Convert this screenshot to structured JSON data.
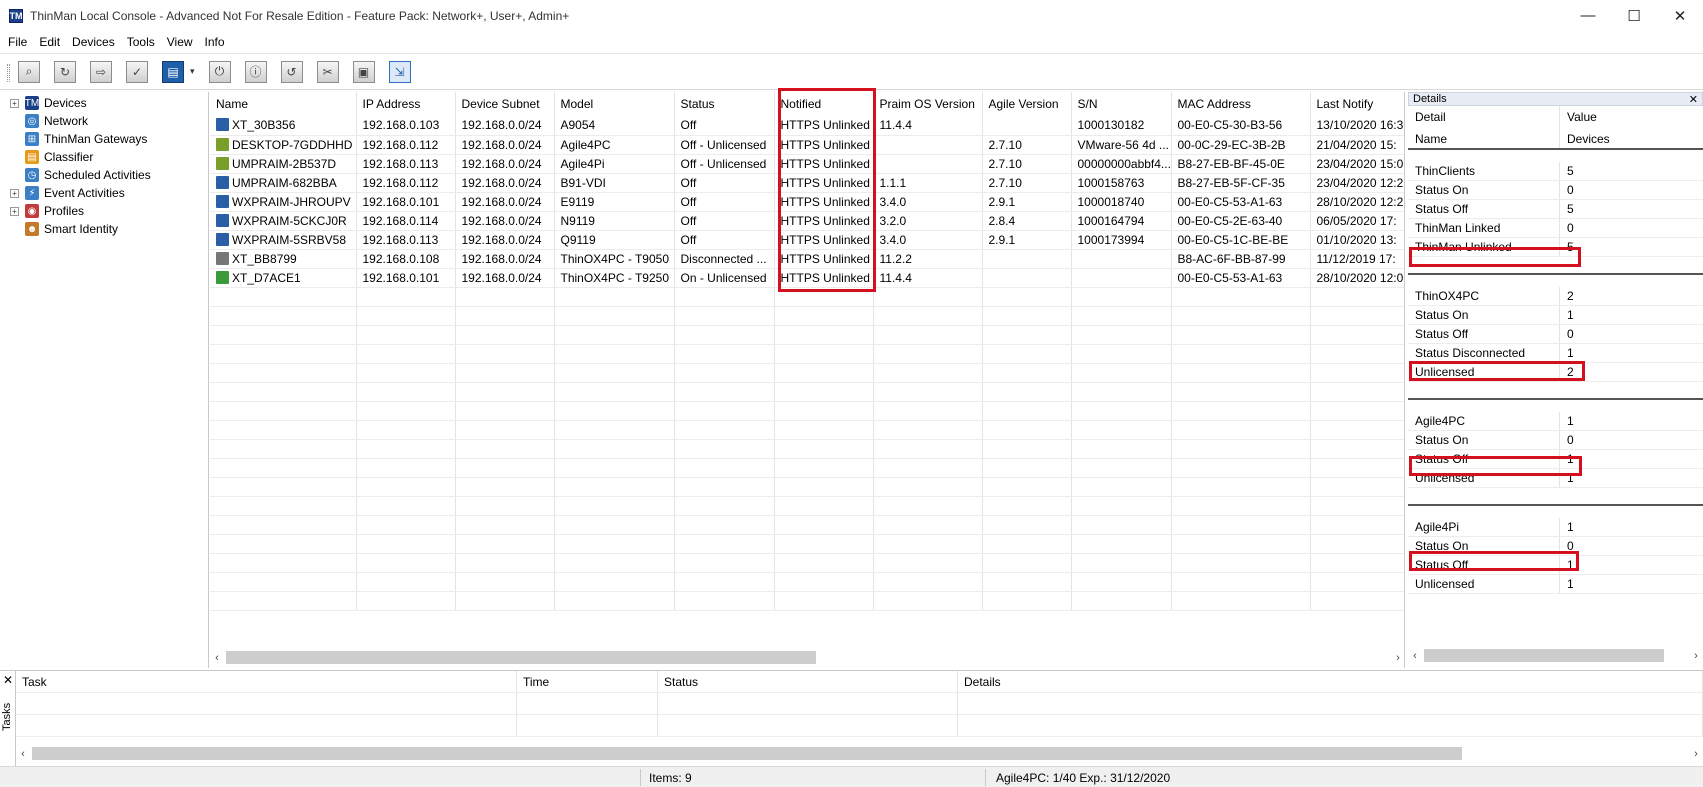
{
  "window": {
    "title": "ThinMan Local Console - Advanced Not For Resale Edition - Feature Pack: Network+, User+, Admin+",
    "app_icon_text": "TM",
    "minimize": "—",
    "maximize": "☐",
    "close": "✕"
  },
  "menu": [
    "File",
    "Edit",
    "Devices",
    "Tools",
    "View",
    "Info"
  ],
  "toolbar": {
    "buttons": [
      "search-icon",
      "refresh-icon",
      "export-icon",
      "checklist-icon",
      "details-view-icon",
      "power-icon",
      "info-icon",
      "undo-icon",
      "tools-icon",
      "window-icon",
      "select-icon"
    ],
    "dropdown": "▾"
  },
  "tree": [
    {
      "label": "Devices",
      "expander": "+",
      "icon": "TM",
      "color": "#1a3f8a"
    },
    {
      "label": "Network",
      "expander": "",
      "icon": "◎",
      "color": "#3c7fc4"
    },
    {
      "label": "ThinMan Gateways",
      "expander": "",
      "icon": "⊞",
      "color": "#3c7fc4"
    },
    {
      "label": "Classifier",
      "expander": "",
      "icon": "▤",
      "color": "#e59a1d"
    },
    {
      "label": "Scheduled Activities",
      "expander": "",
      "icon": "◷",
      "color": "#3c7fc4"
    },
    {
      "label": "Event Activities",
      "expander": "+",
      "icon": "⚡",
      "color": "#3c7fc4"
    },
    {
      "label": "Profiles",
      "expander": "+",
      "icon": "◉",
      "color": "#c23b3b"
    },
    {
      "label": "Smart Identity",
      "expander": "",
      "icon": "☻",
      "color": "#c07a2a"
    }
  ],
  "devices": {
    "columns": [
      "Name",
      "IP Address",
      "Device Subnet",
      "Model",
      "Status",
      "Notified",
      "Praim OS Version",
      "Agile Version",
      "S/N",
      "MAC Address",
      "Last Notify"
    ],
    "rows": [
      {
        "name": "XT_30B356",
        "ip": "192.168.0.103",
        "subnet": "192.168.0.0/24",
        "model": "A9054",
        "status": "Off",
        "notified": "HTTPS Unlinked",
        "os": "11.4.4",
        "agile": "",
        "sn": "1000130182",
        "mac": "00-E0-C5-30-B3-56",
        "last": "13/10/2020 16:3",
        "icon_color": "#2a5fa8"
      },
      {
        "name": "DESKTOP-7GDDHHD",
        "ip": "192.168.0.112",
        "subnet": "192.168.0.0/24",
        "model": "Agile4PC",
        "status": "Off - Unlicensed",
        "notified": "HTTPS Unlinked",
        "os": "",
        "agile": "2.7.10",
        "sn": "VMware-56 4d ...",
        "mac": "00-0C-29-EC-3B-2B",
        "last": "21/04/2020 15:",
        "icon_color": "#7a9e2a"
      },
      {
        "name": "UMPRAIM-2B537D",
        "ip": "192.168.0.113",
        "subnet": "192.168.0.0/24",
        "model": "Agile4Pi",
        "status": "Off - Unlicensed",
        "notified": "HTTPS Unlinked",
        "os": "",
        "agile": "2.7.10",
        "sn": "00000000abbf4...",
        "mac": "B8-27-EB-BF-45-0E",
        "last": "23/04/2020 15:0",
        "icon_color": "#7a9e2a"
      },
      {
        "name": "UMPRAIM-682BBA",
        "ip": "192.168.0.112",
        "subnet": "192.168.0.0/24",
        "model": "B91-VDI",
        "status": "Off",
        "notified": "HTTPS Unlinked",
        "os": "1.1.1",
        "agile": "2.7.10",
        "sn": "1000158763",
        "mac": "B8-27-EB-5F-CF-35",
        "last": "23/04/2020 12:2",
        "icon_color": "#2a5fa8"
      },
      {
        "name": "WXPRAIM-JHROUPV",
        "ip": "192.168.0.101",
        "subnet": "192.168.0.0/24",
        "model": "E9119",
        "status": "Off",
        "notified": "HTTPS Unlinked",
        "os": "3.4.0",
        "agile": "2.9.1",
        "sn": "1000018740",
        "mac": "00-E0-C5-53-A1-63",
        "last": "28/10/2020 12:2",
        "icon_color": "#2a5fa8"
      },
      {
        "name": "WXPRAIM-5CKCJ0R",
        "ip": "192.168.0.114",
        "subnet": "192.168.0.0/24",
        "model": "N9119",
        "status": "Off",
        "notified": "HTTPS Unlinked",
        "os": "3.2.0",
        "agile": "2.8.4",
        "sn": "1000164794",
        "mac": "00-E0-C5-2E-63-40",
        "last": "06/05/2020 17:",
        "icon_color": "#2a5fa8"
      },
      {
        "name": "WXPRAIM-5SRBV58",
        "ip": "192.168.0.113",
        "subnet": "192.168.0.0/24",
        "model": "Q9119",
        "status": "Off",
        "notified": "HTTPS Unlinked",
        "os": "3.4.0",
        "agile": "2.9.1",
        "sn": "1000173994",
        "mac": "00-E0-C5-1C-BE-BE",
        "last": "01/10/2020 13:",
        "icon_color": "#2a5fa8"
      },
      {
        "name": "XT_BB8799",
        "ip": "192.168.0.108",
        "subnet": "192.168.0.0/24",
        "model": "ThinOX4PC - T9050",
        "status": "Disconnected ...",
        "notified": "HTTPS Unlinked",
        "os": "11.2.2",
        "agile": "",
        "sn": "",
        "mac": "B8-AC-6F-BB-87-99",
        "last": "11/12/2019 17:",
        "icon_color": "#777777"
      },
      {
        "name": "XT_D7ACE1",
        "ip": "192.168.0.101",
        "subnet": "192.168.0.0/24",
        "model": "ThinOX4PC - T9250",
        "status": "On - Unlicensed",
        "notified": "HTTPS Unlinked",
        "os": "11.4.4",
        "agile": "",
        "sn": "",
        "mac": "00-E0-C5-53-A1-63",
        "last": "28/10/2020 12:0",
        "icon_color": "#3a9a3a"
      }
    ]
  },
  "details": {
    "title": "Details",
    "close": "✕",
    "col1_header": "Detail",
    "col2_header": "Value",
    "col1_sub": "Name",
    "col2_sub": "Devices",
    "groups": [
      [
        {
          "k": "ThinClients",
          "v": "5"
        },
        {
          "k": "Status On",
          "v": "0"
        },
        {
          "k": "Status Off",
          "v": "5"
        },
        {
          "k": "ThinMan Linked",
          "v": "0"
        },
        {
          "k": "ThinMan Unlinked",
          "v": "5"
        }
      ],
      [
        {
          "k": "ThinOX4PC",
          "v": "2"
        },
        {
          "k": "Status On",
          "v": "1"
        },
        {
          "k": "Status Off",
          "v": "0"
        },
        {
          "k": "Status Disconnected",
          "v": "1"
        },
        {
          "k": "Unlicensed",
          "v": "2"
        }
      ],
      [
        {
          "k": "Agile4PC",
          "v": "1"
        },
        {
          "k": "Status On",
          "v": "0"
        },
        {
          "k": "Status Off",
          "v": "1"
        },
        {
          "k": "Unlicensed",
          "v": "1"
        }
      ],
      [
        {
          "k": "Agile4Pi",
          "v": "1"
        },
        {
          "k": "Status On",
          "v": "0"
        },
        {
          "k": "Status Off",
          "v": "1"
        },
        {
          "k": "Unlicensed",
          "v": "1"
        }
      ]
    ]
  },
  "tasks": {
    "label": "Tasks",
    "close": "✕",
    "columns": [
      "Task",
      "Time",
      "Status",
      "Details"
    ]
  },
  "scroll": {
    "left": "‹",
    "right": "›"
  },
  "statusbar": {
    "items": "Items: 9",
    "license": "Agile4PC: 1/40 Exp.: 31/12/2020"
  },
  "colors": {
    "highlight": "#d4101f",
    "brand": "#1a3f8a"
  }
}
